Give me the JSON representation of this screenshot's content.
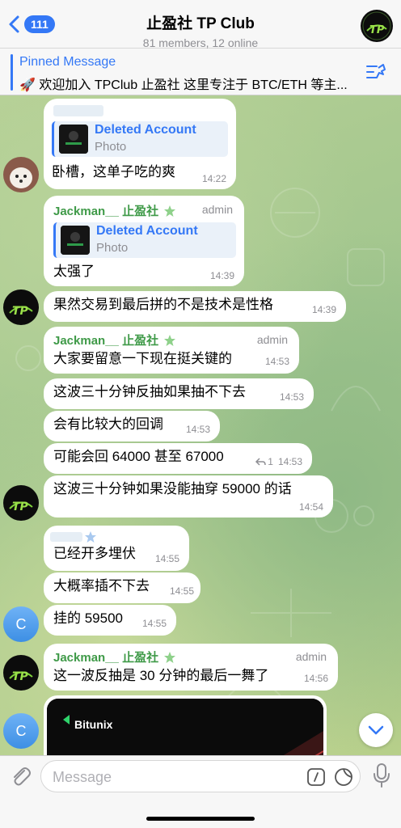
{
  "header": {
    "back_count": "111",
    "title": "止盈社 TP Club",
    "subtitle": "81 members, 12 online"
  },
  "pinned": {
    "title": "Pinned Message",
    "text": "🚀 欢迎加入 TPClub 止盈社 这里专注于 BTC/ETH 等主..."
  },
  "messages": {
    "m1": {
      "reply_name": "Deleted Account",
      "reply_type": "Photo",
      "text": "卧槽，这单子吃的爽",
      "time": "14:22"
    },
    "m2": {
      "sender": "Jackman__ 止盈社",
      "role": "admin",
      "reply_name": "Deleted Account",
      "reply_type": "Photo",
      "text": "太强了",
      "time": "14:39"
    },
    "m3": {
      "text": "果然交易到最后拼的不是技术是性格",
      "time": "14:39"
    },
    "m4": {
      "sender": "Jackman__ 止盈社",
      "role": "admin",
      "text": "大家要留意一下现在挺关键的",
      "time": "14:53"
    },
    "m5": {
      "text": "这波三十分钟反抽如果抽不下去",
      "time": "14:53"
    },
    "m6": {
      "text": "会有比较大的回调",
      "time": "14:53"
    },
    "m7": {
      "text": "可能会回 64000 甚至 67000",
      "reply_count": "1",
      "time": "14:53"
    },
    "m8": {
      "text": "这波三十分钟如果没能抽穿 59000 的话",
      "time": "14:54"
    },
    "m9": {
      "text": "已经开多埋伏",
      "time": "14:55"
    },
    "m10": {
      "text": "大概率插不下去",
      "time": "14:55"
    },
    "m11": {
      "text": "挂的 59500",
      "time": "14:55"
    },
    "m12": {
      "sender": "Jackman__ 止盈社",
      "role": "admin",
      "text": "这一波反抽是 30 分钟的最后一舞了",
      "time": "14:56"
    },
    "m13": {
      "brand": "Bitunix"
    }
  },
  "avatars": {
    "letter_c": "C"
  },
  "input": {
    "placeholder": "Message"
  },
  "colors": {
    "accent": "#3478f6",
    "sender_green": "#3f9a48",
    "bubble": "#ffffff",
    "wallpaper": "#a9c98f"
  }
}
